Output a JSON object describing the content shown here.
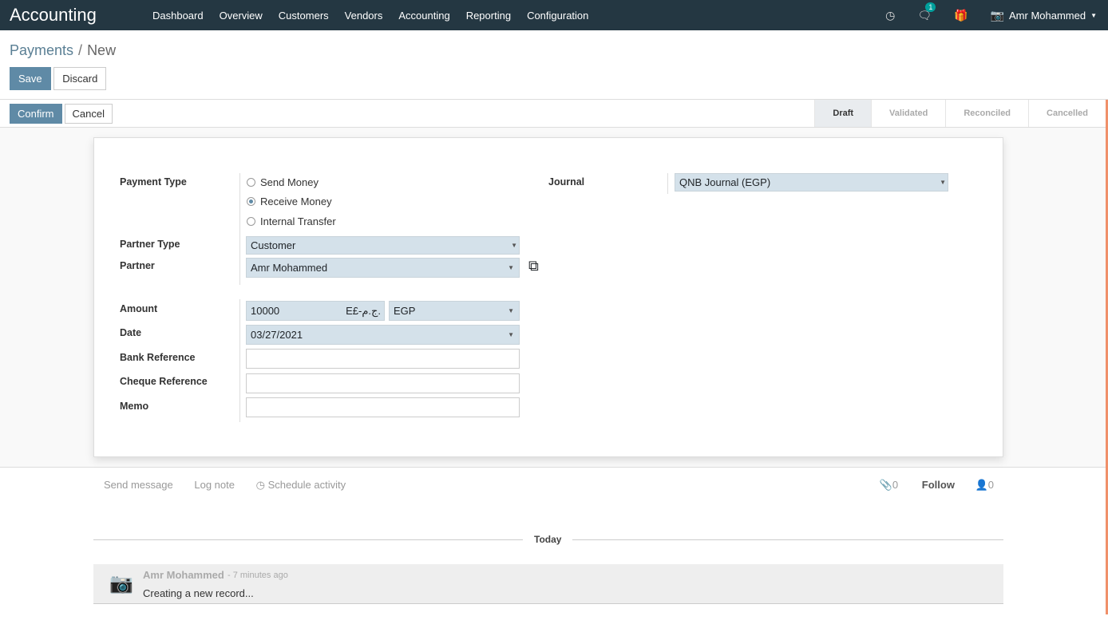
{
  "nav": {
    "brand": "Accounting",
    "menu": [
      "Dashboard",
      "Overview",
      "Customers",
      "Vendors",
      "Accounting",
      "Reporting",
      "Configuration"
    ],
    "messages_count": "1",
    "user": "Amr Mohammed"
  },
  "breadcrumb": {
    "parent": "Payments",
    "sep": "/",
    "current": "New"
  },
  "buttons": {
    "save": "Save",
    "discard": "Discard",
    "confirm": "Confirm",
    "cancel": "Cancel"
  },
  "stages": [
    "Draft",
    "Validated",
    "Reconciled",
    "Cancelled"
  ],
  "form": {
    "payment_type_label": "Payment Type",
    "payment_types": [
      "Send Money",
      "Receive Money",
      "Internal Transfer"
    ],
    "selected_payment_type": "Receive Money",
    "partner_type_label": "Partner Type",
    "partner_type": "Customer",
    "partner_label": "Partner",
    "partner": "Amr Mohammed",
    "amount_label": "Amount",
    "amount": "10000",
    "currency_symbol": "E£-ج.م.",
    "currency": "EGP",
    "date_label": "Date",
    "date": "03/27/2021",
    "bank_ref_label": "Bank Reference",
    "cheque_ref_label": "Cheque Reference",
    "memo_label": "Memo",
    "journal_label": "Journal",
    "journal": "QNB Journal (EGP)"
  },
  "chatter": {
    "send_message": "Send message",
    "log_note": "Log note",
    "schedule": "Schedule activity",
    "attachments": "0",
    "follow": "Follow",
    "followers": "0",
    "today": "Today",
    "author": "Amr Mohammed",
    "time": "- 7 minutes ago",
    "body": "Creating a new record..."
  }
}
